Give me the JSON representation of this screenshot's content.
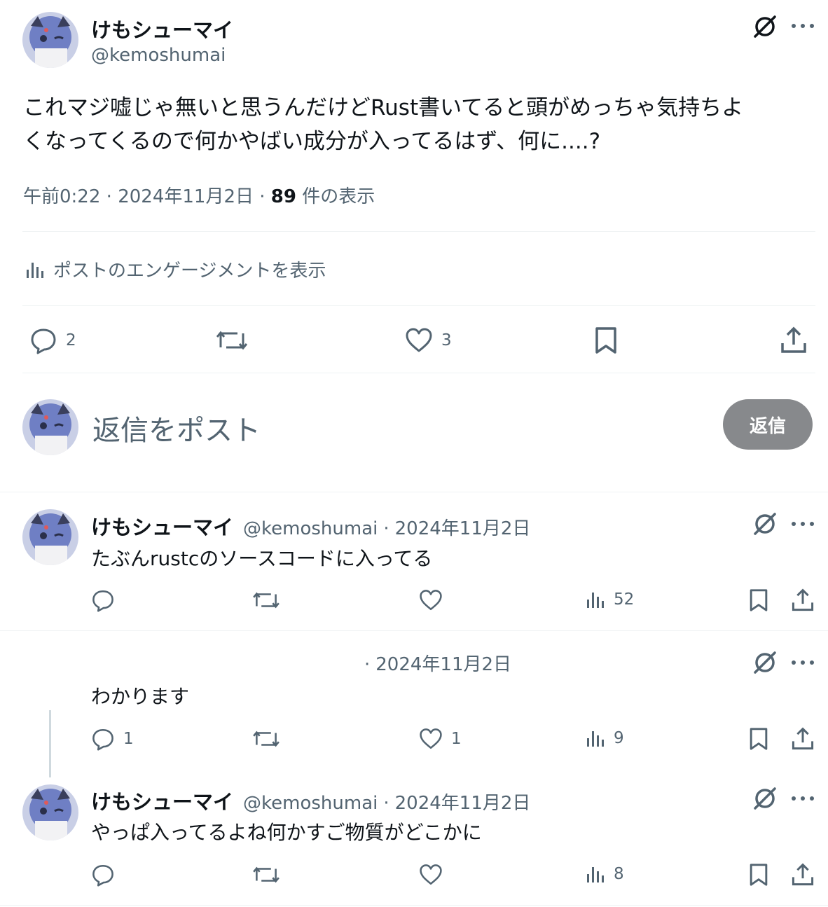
{
  "post": {
    "author_name": "けもシューマイ",
    "author_handle": "@kemoshumai",
    "text_line1": "これマジ嘘じゃ無いと思うんだけどRust書いてると頭がめっちゃ気持ちよ",
    "text_line2": "くなってくるので何かやばい成分が入ってるはず、何に....?",
    "time": "午前0:22",
    "date": "2024年11月2日",
    "views_count": "89",
    "views_label": "件の表示",
    "engagement_link": "ポストのエンゲージメントを表示",
    "reply_count": "2",
    "like_count": "3"
  },
  "composer": {
    "placeholder": "返信をポスト",
    "reply_button": "返信"
  },
  "replies": [
    {
      "author_name": "けもシューマイ",
      "author_handle": "@kemoshumai",
      "date": "2024年11月2日",
      "text": "たぶんrustcのソースコードに入ってる",
      "reply_count": "",
      "like_count": "",
      "view_count": "52"
    },
    {
      "author_name": "",
      "author_handle": "",
      "date": "2024年11月2日",
      "text": "わかります",
      "reply_count": "1",
      "like_count": "1",
      "view_count": "9"
    },
    {
      "author_name": "けもシューマイ",
      "author_handle": "@kemoshumai",
      "date": "2024年11月2日",
      "text": "やっぱ入ってるよね何かすご物質がどこかに",
      "reply_count": "",
      "like_count": "",
      "view_count": "8"
    }
  ],
  "sep": "·",
  "icons": [
    "grok-icon",
    "more-icon",
    "reply-icon",
    "repost-icon",
    "like-icon",
    "bookmark-icon",
    "share-icon",
    "views-icon"
  ],
  "colors": {
    "text": "#0f1419",
    "muted": "#536471",
    "divider": "#eff3f4",
    "reply_button": "#87898c"
  }
}
